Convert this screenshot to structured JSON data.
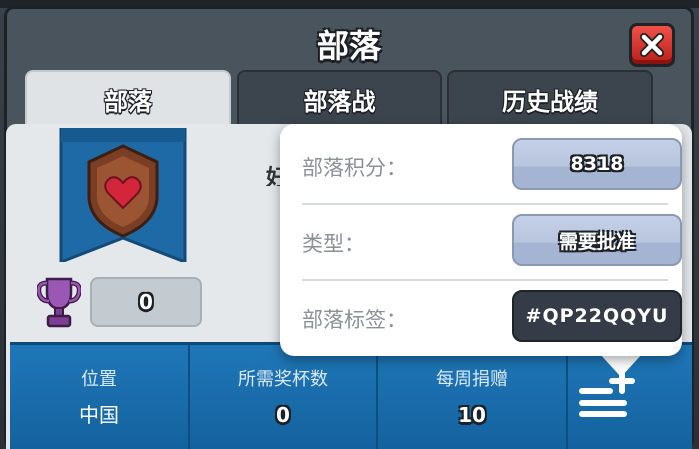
{
  "window": {
    "title": "部落"
  },
  "tabs": [
    {
      "label": "部落",
      "active": true
    },
    {
      "label": "部落战",
      "active": false
    },
    {
      "label": "历史战绩",
      "active": false
    }
  ],
  "clan": {
    "name_fragment": "好",
    "required_trophies_box": "0"
  },
  "stats": {
    "location_label": "位置",
    "location_value": "中国",
    "required_trophies_label": "所需奖杯数",
    "required_trophies_value": "0",
    "weekly_donations_label": "每周捐赠",
    "weekly_donations_value": "10"
  },
  "popup": {
    "score_label": "部落积分：",
    "score_value": "8318",
    "type_label": "类型：",
    "type_value": "需要批准",
    "tag_label": "部落标签：",
    "tag_value": "#QP22QQYU"
  },
  "icons": {
    "close": "close-icon",
    "badge": "heart-shield-badge-icon",
    "trophy": "trophy-icon",
    "menu": "add-list-menu-icon"
  },
  "colors": {
    "close_button": "#e03a32",
    "stats_bar": "#1a6dad",
    "pill": "#b8c5de",
    "tag_pill": "#353c47",
    "trophy": "#8a4aa0"
  }
}
